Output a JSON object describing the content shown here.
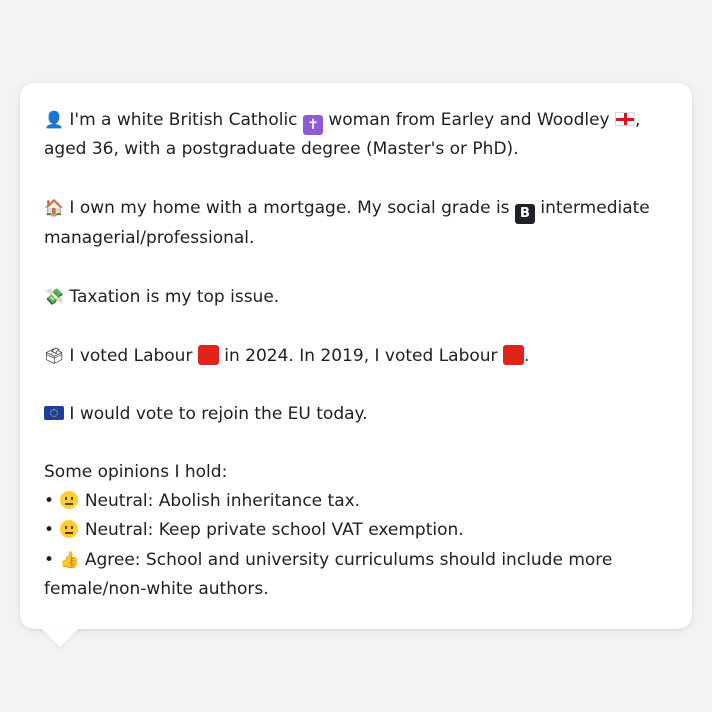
{
  "profile": {
    "line1": "I'm a white British Catholic",
    "line1b": "woman from Earley and Woodley",
    "line1c": ", aged 36, with a postgraduate degree (Master's or PhD).",
    "home": "I own my home with a mortgage. My social grade is",
    "home_b": "intermediate managerial/professional.",
    "top_issue": "Taxation is my top issue.",
    "vote_a": "I voted Labour",
    "vote_b": "in 2024. In 2019, I voted Labour",
    "vote_c": ".",
    "eu": "I would vote to rejoin the EU today.",
    "opinions_header": "Some opinions I hold:",
    "opinions": [
      {
        "bullet": "•",
        "label": "Neutral: Abolish inheritance tax."
      },
      {
        "bullet": "•",
        "label": "Neutral: Keep private school VAT exemption."
      },
      {
        "bullet": "•",
        "label": "Agree: School and university curriculums should include more female/non-white authors."
      }
    ]
  },
  "icons": {
    "person": "👤",
    "house": "🏠",
    "money": "💸",
    "ballot": "🗳",
    "thumbs": "👍",
    "grade_letter": "B",
    "cross": "✝"
  },
  "colors": {
    "page_bg": "#f2f3f5",
    "card_bg": "#ffffff",
    "text": "#1e1f24",
    "labour_red": "#e2231a"
  }
}
